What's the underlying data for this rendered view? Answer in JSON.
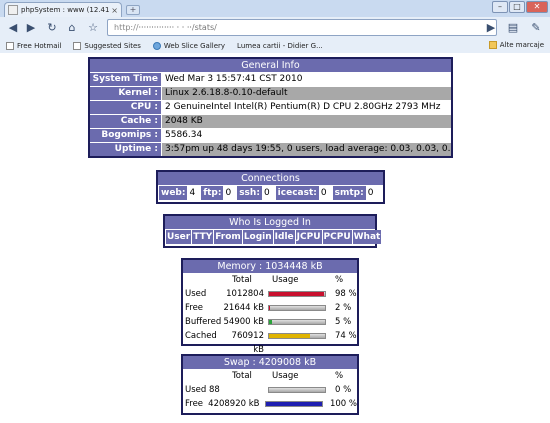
{
  "browser": {
    "tab_title": "phpSystem : www (12.41....",
    "tab_close": "×",
    "new_tab": "+",
    "url_prefix": "http://",
    "url_host": "·············· · · ··",
    "url_path": "/stats/",
    "bookmarks": [
      "Free Hotmail",
      "Suggested Sites",
      "Web Slice Gallery",
      "Lumea cartii - Didier G..."
    ],
    "other_bookmarks": "Alte marcaje"
  },
  "general": {
    "header": "General Info",
    "rows": [
      {
        "key": "System Time :",
        "value": "Wed Mar 3 15:57:41 CST 2010"
      },
      {
        "key": "Kernel :",
        "value": "Linux 2.6.18.8-0.10-default"
      },
      {
        "key": "CPU :",
        "value": "2 GenuineIntel Intel(R) Pentium(R) D CPU 2.80GHz 2793 MHz"
      },
      {
        "key": "Cache :",
        "value": "2048 KB"
      },
      {
        "key": "Bogomips :",
        "value": "5586.34"
      },
      {
        "key": "Uptime :",
        "value": "3:57pm up 48 days 19:55, 0 users, load average: 0.03, 0.03, 0.00"
      }
    ]
  },
  "connections": {
    "header": "Connections",
    "items": [
      {
        "key": "web:",
        "value": "4"
      },
      {
        "key": "ftp:",
        "value": "0"
      },
      {
        "key": "ssh:",
        "value": "0"
      },
      {
        "key": "icecast:",
        "value": "0"
      },
      {
        "key": "smtp:",
        "value": "0"
      }
    ]
  },
  "who": {
    "header": "Who Is Logged In",
    "columns": [
      "User",
      "TTY",
      "From",
      "Login",
      "Idle",
      "JCPU",
      "PCPU",
      "What"
    ]
  },
  "memory": {
    "header": "Memory : 1034448 kB",
    "col_total": "Total",
    "col_usage": "Usage",
    "col_pct": "%",
    "rows": [
      {
        "label": "Used",
        "total": "1012804",
        "pct_text": "98 %",
        "pct": 98,
        "color": "#c8102e"
      },
      {
        "label": "Free",
        "total": "21644 kB",
        "pct_text": "2 %",
        "pct": 2,
        "color": "#c8102e"
      },
      {
        "label": "Buffered",
        "total": "54900 kB",
        "pct_text": "5 %",
        "pct": 5,
        "color": "#2aa43a"
      },
      {
        "label": "Cached",
        "total": "760912 kB",
        "pct_text": "74 %",
        "pct": 74,
        "color": "#e0b400"
      }
    ]
  },
  "swap": {
    "header": "Swap : 4209008 kB",
    "col_total": "Total",
    "col_usage": "Usage",
    "col_pct": "%",
    "rows": [
      {
        "label": "Used",
        "total": "88",
        "pct_text": "0 %",
        "pct": 0,
        "color": "#1f1fb0"
      },
      {
        "label": "Free",
        "total": "4208920 kB",
        "pct_text": "100 %",
        "pct": 100,
        "color": "#1f1fb0"
      }
    ]
  }
}
